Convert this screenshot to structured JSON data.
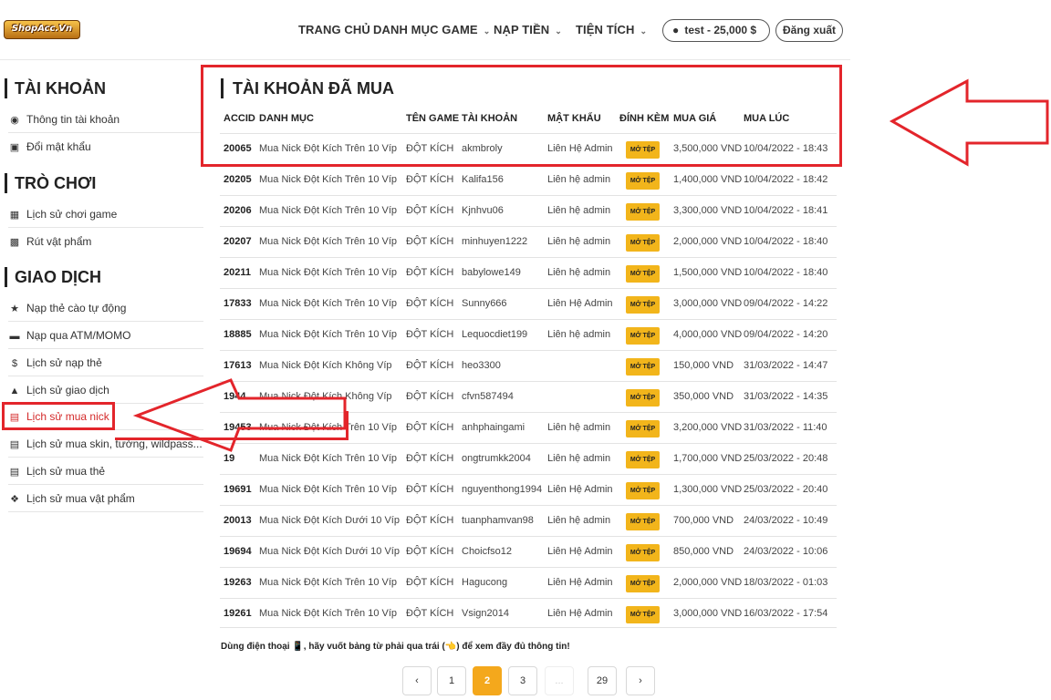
{
  "header": {
    "logo_text": "ShopAcc.Vn",
    "nav": [
      "TRANG CHỦ",
      "DANH MỤC GAME",
      "NẠP TIỀN",
      "TIỆN TÍCH"
    ],
    "user_label": "test - 25,000 $",
    "logout_label": "Đăng xuất"
  },
  "sidebar": {
    "sections": [
      {
        "title": "TÀI KHOẢN",
        "items": [
          {
            "label": "Thông tin tài khoản",
            "icon": "user-circle-icon"
          },
          {
            "label": "Đổi mật khẩu",
            "icon": "lock-icon"
          }
        ]
      },
      {
        "title": "TRÒ CHƠI",
        "items": [
          {
            "label": "Lịch sử chơi game",
            "icon": "gamepad-icon"
          },
          {
            "label": "Rút vật phẩm",
            "icon": "inbox-icon"
          }
        ]
      },
      {
        "title": "GIAO DỊCH",
        "items": [
          {
            "label": "Nạp thẻ cào tự động",
            "icon": "star-icon"
          },
          {
            "label": "Nạp qua ATM/MOMO",
            "icon": "credit-card-icon"
          },
          {
            "label": "Lịch sử nạp thẻ",
            "icon": "dollar-circle-icon"
          },
          {
            "label": "Lịch sử giao dịch",
            "icon": "bank-icon"
          },
          {
            "label": "Lịch sử mua nick",
            "icon": "receipt-icon"
          },
          {
            "label": "Lịch sử mua skin, tướng, wildpass...",
            "icon": "receipt-icon"
          },
          {
            "label": "Lịch sử mua thẻ",
            "icon": "receipt-icon"
          },
          {
            "label": "Lịch sử mua vật phẩm",
            "icon": "dropbox-icon"
          }
        ]
      }
    ]
  },
  "main": {
    "title": "TÀI KHOẢN ĐÃ MUA",
    "columns": [
      "ACCID",
      "DANH MỤC",
      "TÊN GAME",
      "TÀI KHOẢN",
      "MẬT KHẨU",
      "ĐÍNH KÈM",
      "MUA GIÁ",
      "MUA LÚC"
    ],
    "badge_label": "MỞ TỆP",
    "rows": [
      {
        "id": "20065",
        "cat": "Mua Nick Đột Kích Trên 10 Víp",
        "game": "ĐỘT KÍCH",
        "acc": "akmbroly",
        "pw": "Liên Hệ Admin",
        "price": "3,500,000 VND",
        "time": "10/04/2022 - 18:43"
      },
      {
        "id": "20205",
        "cat": "Mua Nick Đột Kích Trên 10 Víp",
        "game": "ĐỘT KÍCH",
        "acc": "Kalifa156",
        "pw": "Liên hệ admin",
        "price": "1,400,000 VND",
        "time": "10/04/2022 - 18:42"
      },
      {
        "id": "20206",
        "cat": "Mua Nick Đột Kích Trên 10 Víp",
        "game": "ĐỘT KÍCH",
        "acc": "Kjnhvu06",
        "pw": "Liên hệ admin",
        "price": "3,300,000 VND",
        "time": "10/04/2022 - 18:41"
      },
      {
        "id": "20207",
        "cat": "Mua Nick Đột Kích Trên 10 Víp",
        "game": "ĐỘT KÍCH",
        "acc": "minhuyen1222",
        "pw": "Liên hệ admin",
        "price": "2,000,000 VND",
        "time": "10/04/2022 - 18:40"
      },
      {
        "id": "20211",
        "cat": "Mua Nick Đột Kích Trên 10 Víp",
        "game": "ĐỘT KÍCH",
        "acc": "babylowe149",
        "pw": "Liên hệ admin",
        "price": "1,500,000 VND",
        "time": "10/04/2022 - 18:40"
      },
      {
        "id": "17833",
        "cat": "Mua Nick Đột Kích Trên 10 Víp",
        "game": "ĐỘT KÍCH",
        "acc": "Sunny666",
        "pw": "Liên Hệ Admin",
        "price": "3,000,000 VND",
        "time": "09/04/2022 - 14:22"
      },
      {
        "id": "18885",
        "cat": "Mua Nick Đột Kích Trên 10 Víp",
        "game": "ĐỘT KÍCH",
        "acc": "Lequocdiet199",
        "pw": "Liên hệ admin",
        "price": "4,000,000 VND",
        "time": "09/04/2022 - 14:20"
      },
      {
        "id": "17613",
        "cat": "Mua Nick Đột Kích Không Víp",
        "game": "ĐỘT KÍCH",
        "acc": "heo3300",
        "pw": "",
        "price": "150,000 VND",
        "time": "31/03/2022 - 14:47"
      },
      {
        "id": "1944",
        "cat": "Mua Nick Đột Kích Không Víp",
        "game": "ĐỘT KÍCH",
        "acc": "cfvn587494",
        "pw": "",
        "price": "350,000 VND",
        "time": "31/03/2022 - 14:35"
      },
      {
        "id": "19453",
        "cat": "Mua Nick Đột Kích Trên 10 Víp",
        "game": "ĐỘT KÍCH",
        "acc": "anhphaingami",
        "pw": "Liên hệ admin",
        "price": "3,200,000 VND",
        "time": "31/03/2022 - 11:40"
      },
      {
        "id": "19",
        "cat": "Mua Nick Đột Kích Trên 10 Víp",
        "game": "ĐỘT KÍCH",
        "acc": "ongtrumkk2004",
        "pw": "Liên hệ admin",
        "price": "1,700,000 VND",
        "time": "25/03/2022 - 20:48"
      },
      {
        "id": "19691",
        "cat": "Mua Nick Đột Kích Trên 10 Víp",
        "game": "ĐỘT KÍCH",
        "acc": "nguyenthong1994",
        "pw": "Liên Hệ Admin",
        "price": "1,300,000 VND",
        "time": "25/03/2022 - 20:40"
      },
      {
        "id": "20013",
        "cat": "Mua Nick Đột Kích Dưới 10 Víp",
        "game": "ĐỘT KÍCH",
        "acc": "tuanphamvan98",
        "pw": "Liên hệ admin",
        "price": "700,000 VND",
        "time": "24/03/2022 - 10:49"
      },
      {
        "id": "19694",
        "cat": "Mua Nick Đột Kích Dưới 10 Víp",
        "game": "ĐỘT KÍCH",
        "acc": "Choicfso12",
        "pw": "Liên Hệ Admin",
        "price": "850,000 VND",
        "time": "24/03/2022 - 10:06"
      },
      {
        "id": "19263",
        "cat": "Mua Nick Đột Kích Trên 10 Víp",
        "game": "ĐỘT KÍCH",
        "acc": "Hagucong",
        "pw": "Liên Hệ Admin",
        "price": "2,000,000 VND",
        "time": "18/03/2022 - 01:03"
      },
      {
        "id": "19261",
        "cat": "Mua Nick Đột Kích Trên 10 Víp",
        "game": "ĐỘT KÍCH",
        "acc": "Vsign2014",
        "pw": "Liên Hệ Admin",
        "price": "3,000,000 VND",
        "time": "16/03/2022 - 17:54"
      }
    ]
  },
  "hint": "Dùng điện thoại 📱, hãy vuốt bảng từ phải qua trái (👈) để xem đầy đủ thông tin!",
  "pagination": [
    "1",
    "2",
    "3",
    "...",
    "29"
  ],
  "pagination_current": "2",
  "annotation_color": "#e3252b",
  "accent_color": "#f4a81c"
}
